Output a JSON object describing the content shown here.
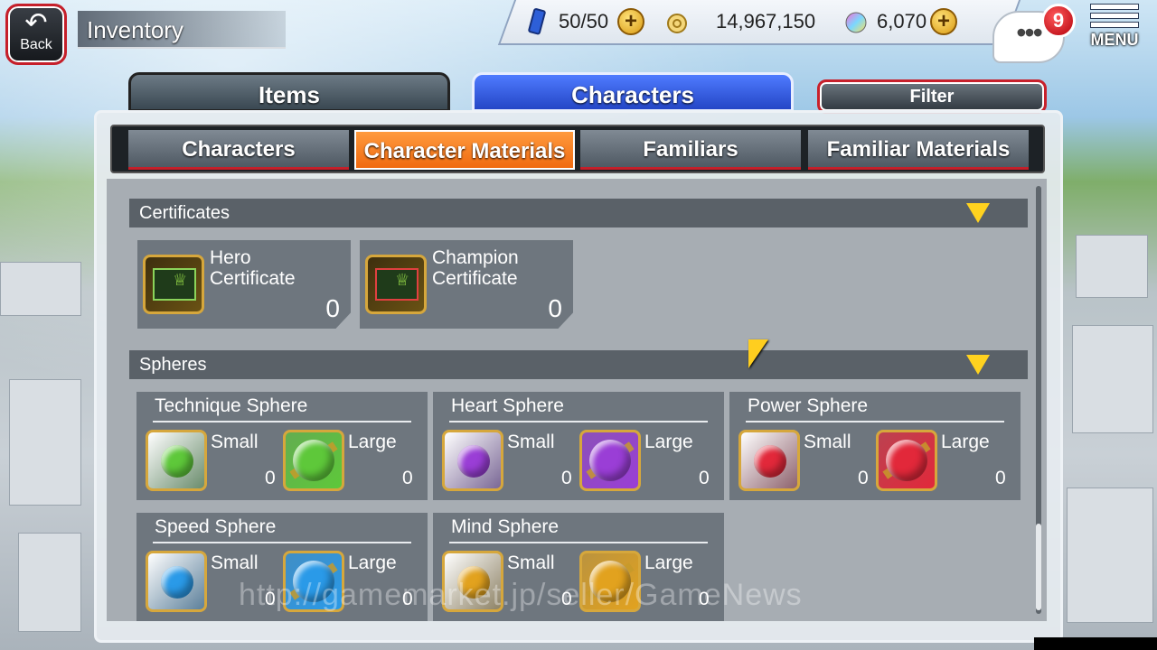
{
  "header": {
    "back_label": "Back",
    "title": "Inventory",
    "menu_label": "MENU",
    "notification_count": "9"
  },
  "resources": {
    "stamina": "50/50",
    "gold": "14,967,150",
    "gems": "6,070"
  },
  "main_tabs": {
    "items": "Items",
    "characters": "Characters",
    "filter": "Filter"
  },
  "sub_tabs": [
    "Characters",
    "Character Materials",
    "Familiars",
    "Familiar Materials"
  ],
  "sections": {
    "certificates": {
      "label": "Certificates",
      "items": [
        {
          "name_line1": "Hero",
          "name_line2": "Certificate",
          "count": "0"
        },
        {
          "name_line1": "Champion",
          "name_line2": "Certificate",
          "count": "0"
        }
      ]
    },
    "spheres": {
      "label": "Spheres",
      "small_label": "Small",
      "large_label": "Large",
      "items": [
        {
          "name": "Technique Sphere",
          "small": "0",
          "large": "0",
          "color": "#5ec83a"
        },
        {
          "name": "Heart Sphere",
          "small": "0",
          "large": "0",
          "color": "#9a3ed6"
        },
        {
          "name": "Power Sphere",
          "small": "0",
          "large": "0",
          "color": "#e2283a"
        },
        {
          "name": "Speed Sphere",
          "small": "0",
          "large": "0",
          "color": "#2a9ae8"
        },
        {
          "name": "Mind Sphere",
          "small": "0",
          "large": "0",
          "color": "#e2a21e"
        }
      ]
    }
  },
  "watermark": "http://gamemarket.jp/seller/GameNews"
}
